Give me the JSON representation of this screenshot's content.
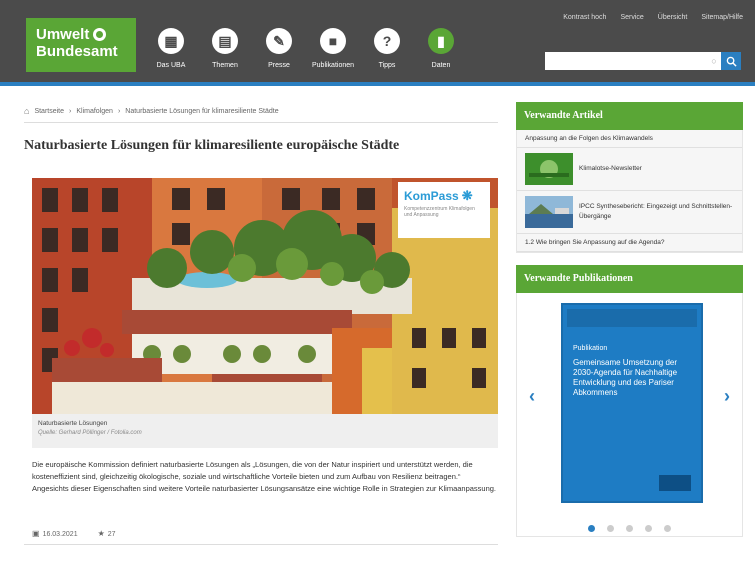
{
  "header": {
    "logo_line1": "Umwelt",
    "logo_line2": "Bundesamt",
    "nav": [
      {
        "label": "Das UBA",
        "icon": "building-icon"
      },
      {
        "label": "Themen",
        "icon": "grid-icon"
      },
      {
        "label": "Presse",
        "icon": "megaphone-icon"
      },
      {
        "label": "Publikationen",
        "icon": "book-icon"
      },
      {
        "label": "Tipps",
        "icon": "lightbulb-icon"
      },
      {
        "label": "Daten",
        "icon": "chart-icon"
      }
    ],
    "top_links": [
      "Kontrast hoch",
      "Service",
      "Übersicht",
      "Sitemap/Hilfe"
    ],
    "search_placeholder": ""
  },
  "content": {
    "breadcrumb": [
      "Startseite",
      "Klimafolgen",
      "Naturbasierte Lösungen für klimaresiliente Städte"
    ],
    "title": "Naturbasierte Lösungen für klimaresiliente europäische Städte",
    "kompass_logo": "KomPass",
    "kompass_sub": "Kompetenzzentrum Klimafolgen und Anpassung",
    "caption_title": "Naturbasierte Lösungen",
    "caption_credit": "Quelle: Gerhard Pöllinger / Fotolia.com",
    "intro": "Die europäische Kommission definiert naturbasierte Lösungen als „Lösungen, die von der Natur inspiriert und unterstützt werden, die kosteneffizient sind, gleichzeitig ökologische, soziale und wirtschaftliche Vorteile bieten und zum Aufbau von Resilienz beitragen.“ Angesichts dieser Eigenschaften sind weitere Vorteile naturbasierter Lösungsansätze eine wichtige Rolle in Strategien zur Klimaanpassung.",
    "date": "16.03.2021",
    "rating": "27"
  },
  "sidebar": {
    "related_title": "Verwandte Artikel",
    "related": [
      "Anpassung an die Folgen des Klimawandels",
      "Klimalotse-Newsletter",
      "IPCC Synthesebericht: Eingezeigt und Schnittstellen-Übergänge",
      "1.2 Wie bringen Sie Anpassung auf die Agenda?"
    ],
    "pub_title": "Verwandte Publikationen",
    "cover_label": "Publikation",
    "cover_title": "Gemeinsame Umsetzung der 2030-Agenda für Nachhaltige Entwicklung und des Pariser Abkommens",
    "dots": 5,
    "active_dot": 0
  },
  "colors": {
    "header": "#4b4b4b",
    "brand_green": "#5aa636",
    "accent_blue": "#2a7fc1"
  }
}
